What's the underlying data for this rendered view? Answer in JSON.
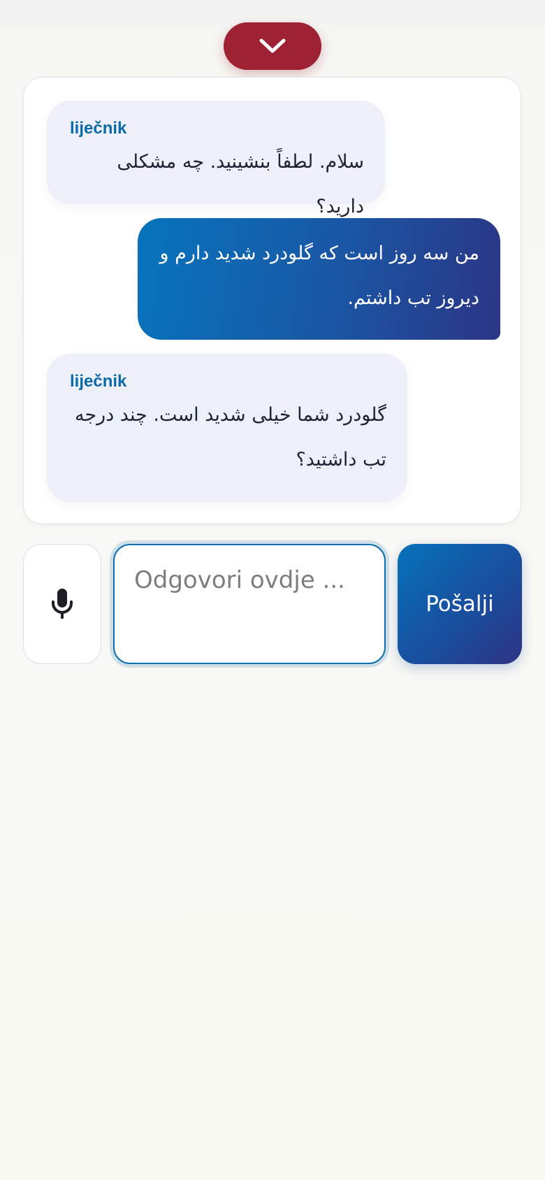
{
  "header": {
    "collapse_icon": "chevron-down-icon",
    "collapse_color": "#9e2233"
  },
  "chat": {
    "messages": [
      {
        "role": "doctor",
        "sender": "liječnik",
        "text": "سلام. لطفاً بنشینید. چه مشکلی دارید؟"
      },
      {
        "role": "patient",
        "text": "من سه روز است که گلودرد شدید دارم و دیروز تب داشتم."
      },
      {
        "role": "doctor",
        "sender": "liječnik",
        "text": "گلودرد شما خیلی شدید است. چند درجه تب داشتید؟"
      }
    ]
  },
  "composer": {
    "mic_icon": "microphone-icon",
    "reply_placeholder": "Odgovori ovdje ...",
    "reply_value": "",
    "send_label": "Pošalji"
  },
  "colors": {
    "accent_blue": "#0774bd",
    "accent_indigo": "#2c3585",
    "doctor_bubble": "#edf0f9",
    "sender_label": "#0c6aa8"
  }
}
